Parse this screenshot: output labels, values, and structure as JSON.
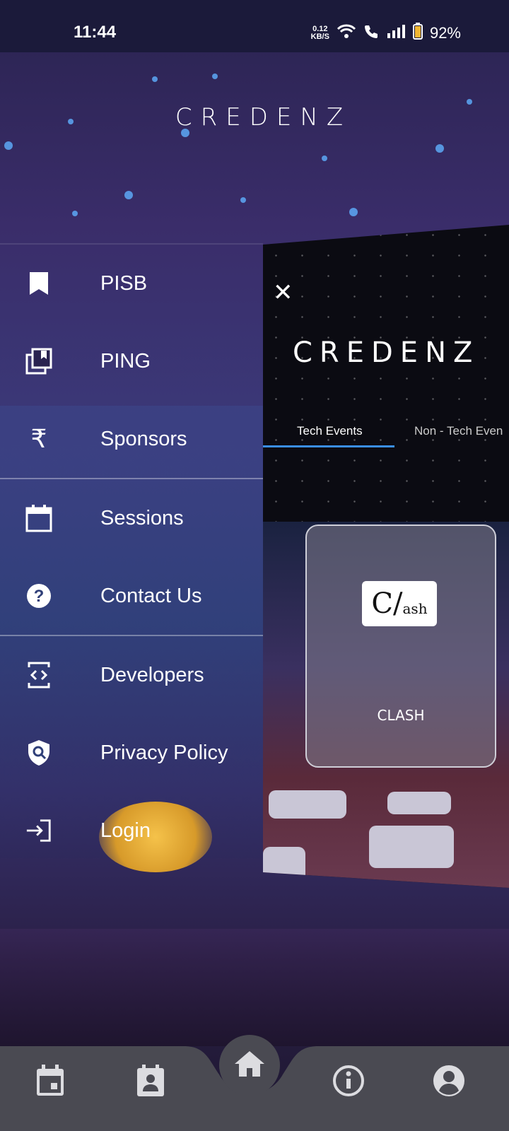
{
  "status_bar": {
    "time": "11:44",
    "net_speed_top": "0.12",
    "net_speed_bottom": "KB/S",
    "battery": "92%"
  },
  "brand": "CREDENZ",
  "drawer": {
    "items": [
      {
        "label": "PISB",
        "icon": "bookmark-icon"
      },
      {
        "label": "PING",
        "icon": "library-icon"
      },
      {
        "label": "Sponsors",
        "icon": "rupee-icon"
      },
      {
        "label": "Sessions",
        "icon": "calendar-icon"
      },
      {
        "label": "Contact Us",
        "icon": "help-icon"
      },
      {
        "label": "Developers",
        "icon": "code-icon"
      },
      {
        "label": "Privacy Policy",
        "icon": "shield-search-icon"
      },
      {
        "label": "Login",
        "icon": "login-icon"
      }
    ]
  },
  "preview": {
    "brand": "CREDENZ",
    "tabs": [
      "Tech Events",
      "Non - Tech Even"
    ],
    "event": {
      "logo_main": "C/",
      "logo_small": "ash",
      "title": "CLASH"
    }
  },
  "bottom_nav": {
    "items": [
      "calendar-icon",
      "contacts-icon",
      "home-icon",
      "info-icon",
      "account-icon"
    ]
  },
  "colors": {
    "accent": "#3a8eea",
    "status_bar": "#1b1a3a",
    "nav_bg": "#4a4a52"
  }
}
